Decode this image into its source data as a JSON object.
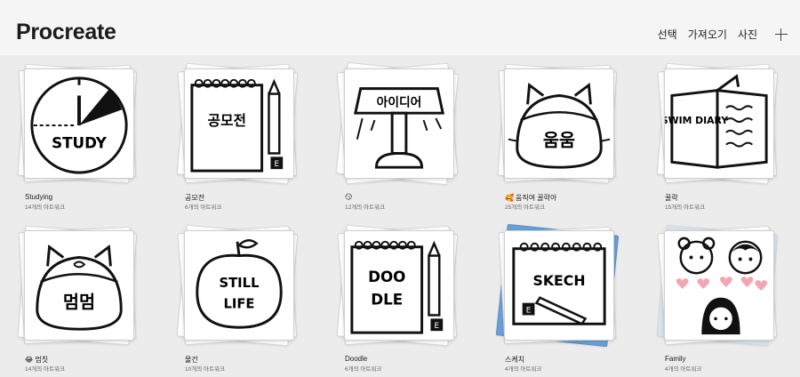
{
  "header": {
    "app_title": "Procreate",
    "actions": {
      "select": "선택",
      "import": "가져오기",
      "photo": "사진"
    }
  },
  "stacks": [
    {
      "name": "Studying",
      "count": "14개의 아트워크",
      "emoji": "",
      "cover_text": "STUDY"
    },
    {
      "name": "공모전",
      "count": "6개의 아트워크",
      "emoji": "",
      "cover_text": "공모전"
    },
    {
      "name": "",
      "count": "12개의 아트워크",
      "emoji": "😏",
      "cover_text": "아이디어"
    },
    {
      "name": "움직여 꿀락아",
      "count": "25개의 아트워크",
      "emoji": "🥰",
      "cover_text": "움움"
    },
    {
      "name": "꿀락",
      "count": "15개의 아트워크",
      "emoji": "",
      "cover_text": "SWIM DIARY"
    },
    {
      "name": "멈칫",
      "count": "14개의 아트워크",
      "emoji": "😂",
      "cover_text": "멈멈"
    },
    {
      "name": "물건",
      "count": "10개의 아트워크",
      "emoji": "",
      "cover_text": "STILL LIFE"
    },
    {
      "name": "Doodle",
      "count": "6개의 아트워크",
      "emoji": "",
      "cover_text": "DOO DLE"
    },
    {
      "name": "스케치",
      "count": "4개의 아트워크",
      "emoji": "",
      "cover_text": "SKECH"
    },
    {
      "name": "Family",
      "count": "4개의 아트워크",
      "emoji": "",
      "cover_text": ""
    }
  ]
}
